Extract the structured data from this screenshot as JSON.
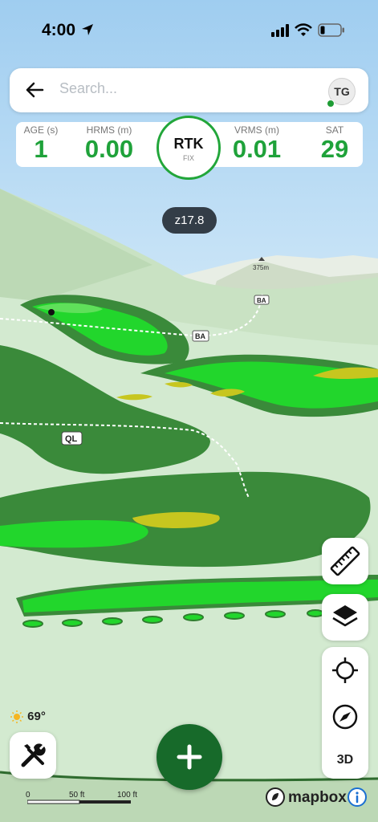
{
  "status_bar": {
    "time": "4:00"
  },
  "search": {
    "placeholder": "Search...",
    "avatar_initials": "TG"
  },
  "gnss": {
    "age": {
      "label": "AGE (s)",
      "value": "1"
    },
    "hrms": {
      "label": "HRMS (m)",
      "value": "0.00"
    },
    "fix": {
      "mode": "RTK",
      "status": "FIX"
    },
    "vrms": {
      "label": "VRMS (m)",
      "value": "0.01"
    },
    "sat": {
      "label": "SAT",
      "value": "29"
    }
  },
  "map": {
    "zoom_label": "z17.8",
    "peak_label": "375m",
    "road_labels": [
      "BA",
      "BA",
      "QL"
    ],
    "colors": {
      "dark_green": "#3a8a3a",
      "bright_green": "#22d62c",
      "light_green": "#5fe05a",
      "yellow": "#c7c61f",
      "pale": "#d7ecd2",
      "sky": "#a9d3f2"
    }
  },
  "controls": {
    "three_d_label": "3D"
  },
  "weather": {
    "temperature": "69°"
  },
  "scale": {
    "labels": [
      "0",
      "50 ft",
      "100 ft"
    ]
  },
  "attribution": {
    "brand": "mapbox"
  },
  "icons": [
    "location-arrow-icon",
    "signal-icon",
    "wifi-icon",
    "battery-icon",
    "back-arrow-icon",
    "ruler-icon",
    "layers-icon",
    "crosshair-icon",
    "compass-icon",
    "tools-icon",
    "plus-icon",
    "sun-icon",
    "mapbox-logo-icon",
    "info-icon"
  ]
}
